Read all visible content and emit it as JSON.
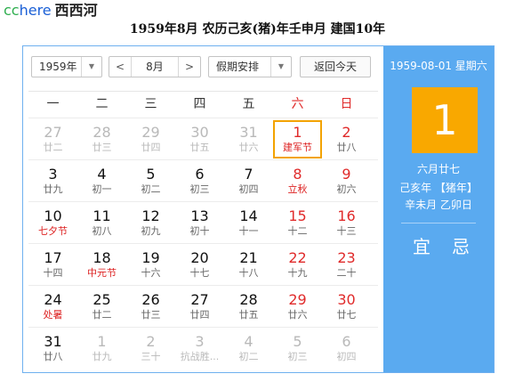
{
  "brand": {
    "cc": "cc",
    "here": "here",
    "site": "西西河"
  },
  "headline": "1959年8月  农历己亥(猪)年壬申月  建国10年",
  "toolbar": {
    "year_value": "1959年",
    "prev_label": "<",
    "month_value": "8月",
    "next_label": ">",
    "holiday_value": "假期安排",
    "today_label": "返回今天",
    "dropdown_arrow": "▼"
  },
  "weekdays": [
    "一",
    "二",
    "三",
    "四",
    "五",
    "六",
    "日"
  ],
  "weeks": [
    [
      {
        "n": "27",
        "l": "廿二",
        "other": true
      },
      {
        "n": "28",
        "l": "廿三",
        "other": true
      },
      {
        "n": "29",
        "l": "廿四",
        "other": true
      },
      {
        "n": "30",
        "l": "廿五",
        "other": true
      },
      {
        "n": "31",
        "l": "廿六",
        "other": true
      },
      {
        "n": "1",
        "l": "建军节",
        "fest": true,
        "selected": true
      },
      {
        "n": "2",
        "l": "廿八"
      }
    ],
    [
      {
        "n": "3",
        "l": "廿九"
      },
      {
        "n": "4",
        "l": "初一"
      },
      {
        "n": "5",
        "l": "初二"
      },
      {
        "n": "6",
        "l": "初三"
      },
      {
        "n": "7",
        "l": "初四"
      },
      {
        "n": "8",
        "l": "立秋",
        "fest": true
      },
      {
        "n": "9",
        "l": "初六"
      }
    ],
    [
      {
        "n": "10",
        "l": "七夕节",
        "fest": true
      },
      {
        "n": "11",
        "l": "初八"
      },
      {
        "n": "12",
        "l": "初九"
      },
      {
        "n": "13",
        "l": "初十"
      },
      {
        "n": "14",
        "l": "十一"
      },
      {
        "n": "15",
        "l": "十二"
      },
      {
        "n": "16",
        "l": "十三"
      }
    ],
    [
      {
        "n": "17",
        "l": "十四"
      },
      {
        "n": "18",
        "l": "中元节",
        "fest": true
      },
      {
        "n": "19",
        "l": "十六"
      },
      {
        "n": "20",
        "l": "十七"
      },
      {
        "n": "21",
        "l": "十八"
      },
      {
        "n": "22",
        "l": "十九"
      },
      {
        "n": "23",
        "l": "二十"
      }
    ],
    [
      {
        "n": "24",
        "l": "处暑",
        "fest": true
      },
      {
        "n": "25",
        "l": "廿二"
      },
      {
        "n": "26",
        "l": "廿三"
      },
      {
        "n": "27",
        "l": "廿四"
      },
      {
        "n": "28",
        "l": "廿五"
      },
      {
        "n": "29",
        "l": "廿六"
      },
      {
        "n": "30",
        "l": "廿七"
      }
    ],
    [
      {
        "n": "31",
        "l": "廿八"
      },
      {
        "n": "1",
        "l": "廿九",
        "other": true
      },
      {
        "n": "2",
        "l": "三十",
        "other": true
      },
      {
        "n": "3",
        "l": "抗战胜...",
        "other": true
      },
      {
        "n": "4",
        "l": "初二",
        "other": true
      },
      {
        "n": "5",
        "l": "初三",
        "other": true
      },
      {
        "n": "6",
        "l": "初四",
        "other": true
      }
    ]
  ],
  "side": {
    "date_line": "1959-08-01 星期六",
    "big_day": "1",
    "lunar": "六月廿七",
    "ganzhi_year": "己亥年 【猪年】",
    "ganzhi_month_day": "辛未月 乙卯日",
    "yi": "宜",
    "ji": "忌"
  },
  "colors": {
    "accent": "#5aaaf0",
    "highlight": "#f9a800",
    "weekend": "#e02a2a"
  }
}
